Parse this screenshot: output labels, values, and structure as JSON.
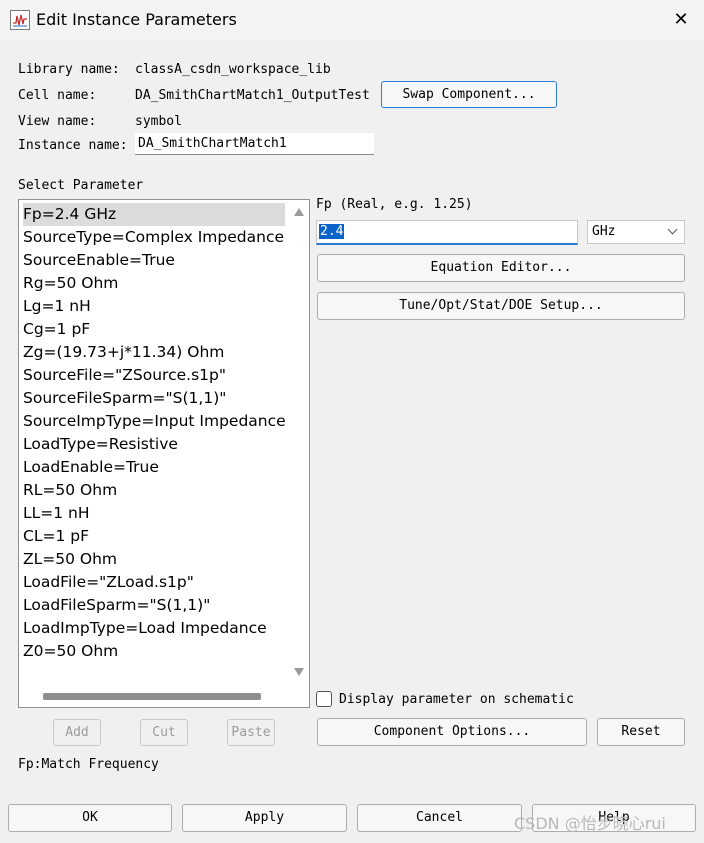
{
  "window": {
    "title": "Edit Instance Parameters",
    "close_glyph": "✕"
  },
  "info": {
    "library_label": "Library name:",
    "library_value": "classA_csdn_workspace_lib",
    "cell_label": "Cell name:",
    "cell_value": "DA_SmithChartMatch1_OutputTest",
    "view_label": "View name:",
    "view_value": "symbol",
    "instance_label": "Instance name:",
    "instance_value": "DA_SmithChartMatch1",
    "swap_button": "Swap Component..."
  },
  "parameters": {
    "section_label": "Select Parameter",
    "selected_index": 0,
    "items": [
      "Fp=2.4 GHz",
      "SourceType=Complex Impedance",
      "SourceEnable=True",
      "Rg=50 Ohm",
      "Lg=1 nH",
      "Cg=1 pF",
      "Zg=(19.73+j*11.34) Ohm",
      "SourceFile=\"ZSource.s1p\"",
      "SourceFileSparm=\"S(1,1)\"",
      "SourceImpType=Input Impedance",
      "LoadType=Resistive",
      "LoadEnable=True",
      "RL=50 Ohm",
      "LL=1 nH",
      "CL=1 pF",
      "ZL=50 Ohm",
      "LoadFile=\"ZLoad.s1p\"",
      "LoadFileSparm=\"S(1,1)\"",
      "LoadImpType=Load Impedance",
      "Z0=50 Ohm"
    ],
    "add_button": "Add",
    "cut_button": "Cut",
    "paste_button": "Paste"
  },
  "editor": {
    "param_hint": "Fp (Real, e.g. 1.25)",
    "value": "2.4",
    "unit": "GHz",
    "equation_button": "Equation Editor...",
    "tune_button": "Tune/Opt/Stat/DOE Setup...",
    "display_checkbox_label": "Display parameter on schematic",
    "display_checked": false,
    "component_options_button": "Component Options...",
    "reset_button": "Reset"
  },
  "description": "Fp:Match Frequency",
  "footer": {
    "ok": "OK",
    "apply": "Apply",
    "cancel": "Cancel",
    "help": "Help"
  },
  "watermark": "CSDN @怡步晓心rui",
  "colors": {
    "accent": "#2b7cd3",
    "selection": "#0a64c8",
    "list_selected": "#dcdcdc"
  }
}
